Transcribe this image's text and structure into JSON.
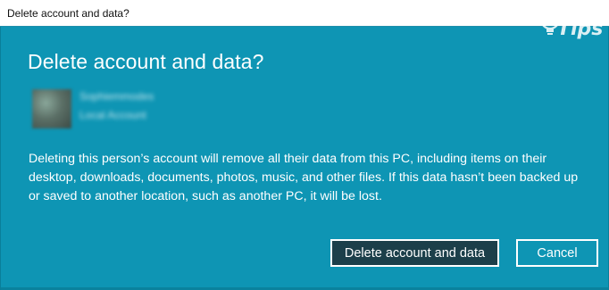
{
  "window": {
    "title": "Delete account and data?"
  },
  "dialog": {
    "heading": "Delete account and data?",
    "account": {
      "name": "Sophiemmodes",
      "type": "Local Account"
    },
    "message": "Deleting this person’s account will remove all their data from this PC, including items on their desktop, downloads, documents, photos, music, and other files. If this data hasn’t been backed up or saved to another location, such as another PC, it will be lost.",
    "buttons": {
      "primary": "Delete account and data",
      "secondary": "Cancel"
    }
  },
  "watermark": {
    "text": "Tips",
    "icon": "lightbulb-icon"
  },
  "colors": {
    "panel": "#0e95b4",
    "primary_button": "#1c3f4a"
  }
}
